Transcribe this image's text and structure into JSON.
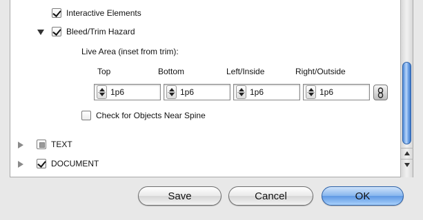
{
  "panel": {
    "rows": [
      {
        "label": "Interactive Elements",
        "checked": true
      },
      {
        "label": "Bleed/Trim Hazard",
        "checked": true,
        "expanded": true
      }
    ],
    "live_area": {
      "label": "Live Area (inset from trim):",
      "columns": [
        "Top",
        "Bottom",
        "Left/Inside",
        "Right/Outside"
      ],
      "values": [
        "1p6",
        "1p6",
        "1p6",
        "1p6"
      ]
    },
    "spine_check": {
      "label": "Check for Objects Near Spine",
      "checked": false
    },
    "sections": [
      {
        "label": "TEXT",
        "state": "mixed"
      },
      {
        "label": "DOCUMENT",
        "state": "checked"
      }
    ]
  },
  "buttons": {
    "save": "Save",
    "cancel": "Cancel",
    "ok": "OK"
  },
  "colors": {
    "accent": "#5e98e4",
    "scroll_thumb": "#4d8ad8"
  }
}
